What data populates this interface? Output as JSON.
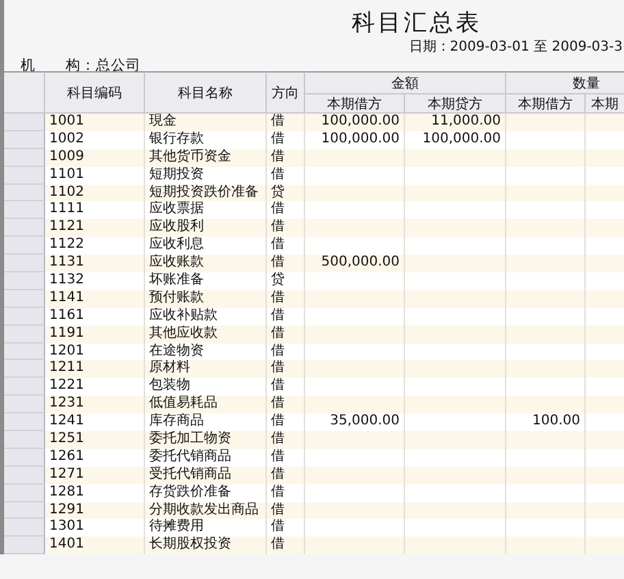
{
  "report": {
    "title": "科目汇总表",
    "date_range": "日期：2009-03-01 至 2009-03-3",
    "organization": "机　　构：总公司"
  },
  "table": {
    "columns": [
      {
        "label": "科目编码"
      },
      {
        "label": "科目名称"
      },
      {
        "label": "方向"
      }
    ],
    "groups": [
      {
        "label": "金額",
        "subcolumns": [
          "本期借方",
          "本期贷方"
        ]
      },
      {
        "label": "数量",
        "subcolumns": [
          "本期借方",
          "本期"
        ]
      }
    ],
    "rows": [
      {
        "code": "1001",
        "name": "現金",
        "direction": "借",
        "amount_debit": "100,000.00",
        "amount_credit": "11,000.00"
      },
      {
        "code": "1002",
        "name": "银行存款",
        "direction": "借",
        "amount_debit": "100,000.00",
        "amount_credit": "100,000.00"
      },
      {
        "code": "1009",
        "name": "其他货币资金",
        "direction": "借"
      },
      {
        "code": "1101",
        "name": "短期投资",
        "direction": "借"
      },
      {
        "code": "1102",
        "name": "短期投资跌价准备",
        "direction": "贷"
      },
      {
        "code": "1111",
        "name": "应收票据",
        "direction": "借"
      },
      {
        "code": "1121",
        "name": "应收股利",
        "direction": "借"
      },
      {
        "code": "1122",
        "name": "应收利息",
        "direction": "借"
      },
      {
        "code": "1131",
        "name": "应收账款",
        "direction": "借",
        "amount_debit": "500,000.00"
      },
      {
        "code": "1132",
        "name": "坏账准备",
        "direction": "贷"
      },
      {
        "code": "1141",
        "name": "预付账款",
        "direction": "借"
      },
      {
        "code": "1161",
        "name": "应收补贴款",
        "direction": "借"
      },
      {
        "code": "1191",
        "name": "其他应收款",
        "direction": "借"
      },
      {
        "code": "1201",
        "name": "在途物资",
        "direction": "借"
      },
      {
        "code": "1211",
        "name": "原材料",
        "direction": "借"
      },
      {
        "code": "1221",
        "name": "包装物",
        "direction": "借"
      },
      {
        "code": "1231",
        "name": "低值易耗品",
        "direction": "借"
      },
      {
        "code": "1241",
        "name": "库存商品",
        "direction": "借",
        "amount_debit": "35,000.00",
        "quantity_debit": "100.00"
      },
      {
        "code": "1251",
        "name": "委托加工物资",
        "direction": "借"
      },
      {
        "code": "1261",
        "name": "委托代销商品",
        "direction": "借"
      },
      {
        "code": "1271",
        "name": "受托代销商品",
        "direction": "借"
      },
      {
        "code": "1281",
        "name": "存货跌价准备",
        "direction": "借"
      },
      {
        "code": "1291",
        "name": "分期收款发出商品",
        "direction": "借"
      },
      {
        "code": "1301",
        "name": "待摊费用",
        "direction": "借"
      },
      {
        "code": "1401",
        "name": "长期股权投资",
        "direction": "借"
      }
    ]
  }
}
